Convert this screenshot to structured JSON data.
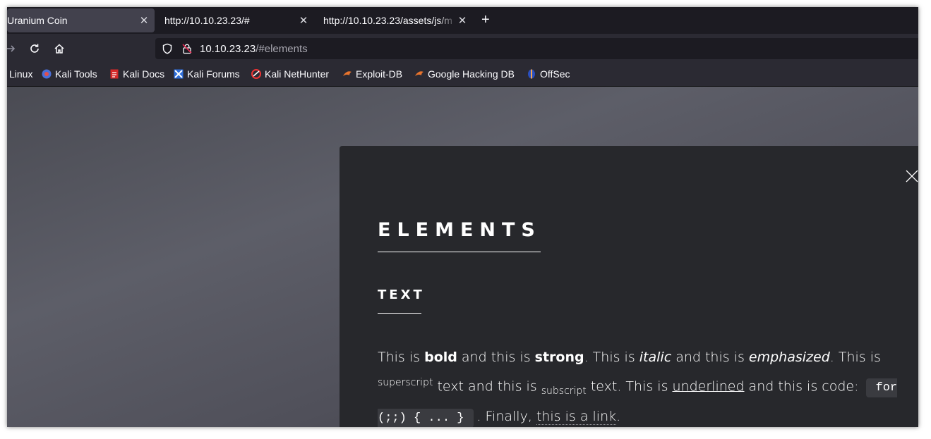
{
  "tabs": [
    {
      "label": "Uranium Coin",
      "active": true
    },
    {
      "label": "http://10.10.23.23/#",
      "active": false
    },
    {
      "label": "http://10.10.23.23/assets/js/m",
      "active": false
    }
  ],
  "url": {
    "host": "10.10.23.23",
    "path": "/#elements"
  },
  "bookmarks": [
    {
      "label": "Linux",
      "icon": "kali-icon"
    },
    {
      "label": "Kali Tools",
      "icon": "kali-tools-icon"
    },
    {
      "label": "Kali Docs",
      "icon": "kali-docs-icon"
    },
    {
      "label": "Kali Forums",
      "icon": "kali-forums-icon"
    },
    {
      "label": "Kali NetHunter",
      "icon": "nethunter-icon"
    },
    {
      "label": "Exploit-DB",
      "icon": "exploit-db-icon"
    },
    {
      "label": "Google Hacking DB",
      "icon": "ghdb-icon"
    },
    {
      "label": "OffSec",
      "icon": "offsec-icon"
    }
  ],
  "panel": {
    "heading": "ELEMENTS",
    "subheading": "TEXT",
    "para": {
      "t1": "This is ",
      "bold": "bold",
      "t2": " and this is ",
      "strong": "strong",
      "t3": ". This is ",
      "italic": "italic",
      "t4": " and this is ",
      "emph": "emphasized",
      "t5": ". This is ",
      "sup": "superscript",
      "t6": " text and this is ",
      "sub": "subscript",
      "t7": " text. This is ",
      "underline": "underlined",
      "t8": " and this is code: ",
      "code": "for (;;) { ... }",
      "t9": ". Finally, ",
      "link": "this is a link",
      "t10": "."
    }
  },
  "colors": {
    "accent": "#ffffff",
    "window_bg": "#1c1b22",
    "toolbar_bg": "#2b2a33",
    "panel_bg": "#27282c"
  }
}
